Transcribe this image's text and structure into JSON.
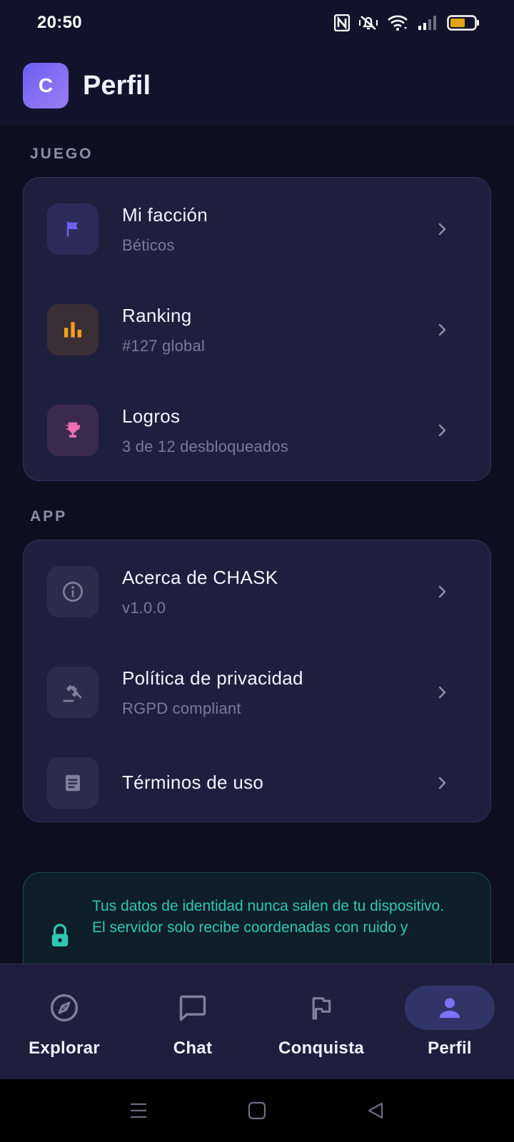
{
  "status_bar": {
    "time": "20:50",
    "icons": [
      "nfc-icon",
      "vibrate-off-icon",
      "wifi-icon",
      "signal-icon",
      "battery-icon"
    ],
    "battery_color": "#e0a31a"
  },
  "header": {
    "avatar_letter": "C",
    "title": "Perfil"
  },
  "sections": {
    "game": {
      "label": "JUEGO",
      "items": [
        {
          "title": "Mi facción",
          "subtitle": "Béticos",
          "icon": "flag-icon",
          "accent": "#6b63f0"
        },
        {
          "title": "Ranking",
          "subtitle": "#127 global",
          "icon": "bar-chart-icon",
          "accent": "#f0a020"
        },
        {
          "title": "Logros",
          "subtitle": "3 de 12 desbloqueados",
          "icon": "trophy-icon",
          "accent": "#ec6fb0"
        }
      ]
    },
    "app": {
      "label": "APP",
      "items": [
        {
          "title": "Acerca de CHASK",
          "subtitle": "v1.0.0",
          "icon": "info-icon"
        },
        {
          "title": "Política de privacidad",
          "subtitle": "RGPD compliant",
          "icon": "gavel-icon"
        },
        {
          "title": "Términos de uso",
          "subtitle": "",
          "icon": "document-icon"
        }
      ]
    }
  },
  "privacy_notice": {
    "line1": "Tus datos de identidad nunca salen de tu dispositivo.",
    "line2": "El servidor solo recibe coordenadas con ruido y",
    "icon": "lock-icon",
    "accent": "#2fc8b0"
  },
  "bottom_nav": {
    "items": [
      {
        "label": "Explorar",
        "icon": "compass-icon",
        "active": false
      },
      {
        "label": "Chat",
        "icon": "chat-icon",
        "active": false
      },
      {
        "label": "Conquista",
        "icon": "flag-outline-icon",
        "active": false
      },
      {
        "label": "Perfil",
        "icon": "person-icon",
        "active": true
      }
    ],
    "active_color": "#7a73f5"
  }
}
